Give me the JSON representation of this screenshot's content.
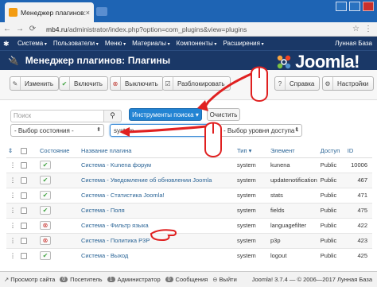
{
  "browser": {
    "tab_title": "Менеджер плагинов: П",
    "tab_close": "×",
    "url_host": "mb4.ru",
    "url_path": "/administrator/index.php?option=com_plugins&view=plugins"
  },
  "menu": {
    "items": [
      "Система",
      "Пользователи",
      "Меню",
      "Материалы",
      "Компоненты",
      "Расширения"
    ],
    "right": "Лунная База"
  },
  "header": {
    "title": "Менеджер плагинов: Плагины",
    "logo_text": "Joomla!"
  },
  "toolbar": {
    "edit": "Изменить",
    "enable": "Включить",
    "disable": "Выключить",
    "unlock": "Разблокировать",
    "help": "Справка",
    "options": "Настройки"
  },
  "filters": {
    "search_placeholder": "Поиск",
    "search_tools": "Инструменты поиска ▾",
    "clear": "Очистить",
    "state": "- Выбор состояния -",
    "folder": "system",
    "access": "- Выбор уровня доступа -"
  },
  "table": {
    "columns": [
      "",
      "",
      "Состояние",
      "Название плагина",
      "Тип ▾",
      "Элемент",
      "Доступ",
      "ID"
    ],
    "rows": [
      {
        "status": "on",
        "name": "Система - Kunena форум",
        "type": "system",
        "element": "kunena",
        "access": "Public",
        "id": "10006"
      },
      {
        "status": "on",
        "name": "Система - Уведомление об обновлении Joomla",
        "type": "system",
        "element": "updatenotification",
        "access": "Public",
        "id": "467"
      },
      {
        "status": "on",
        "name": "Система - Статистика Joomla!",
        "type": "system",
        "element": "stats",
        "access": "Public",
        "id": "471"
      },
      {
        "status": "on",
        "name": "Система - Поля",
        "type": "system",
        "element": "fields",
        "access": "Public",
        "id": "475"
      },
      {
        "status": "off",
        "name": "Система - Фильтр языка",
        "type": "system",
        "element": "languagefilter",
        "access": "Public",
        "id": "422"
      },
      {
        "status": "off",
        "name": "Система - Политика P3P",
        "type": "system",
        "element": "p3p",
        "access": "Public",
        "id": "423"
      },
      {
        "status": "on",
        "name": "Система - Выход",
        "type": "system",
        "element": "logout",
        "access": "Public",
        "id": "425"
      }
    ]
  },
  "statusbar": {
    "view_site": "Просмотр сайта",
    "visitors_count": "0",
    "visitors": "Посетитель",
    "admins_count": "1",
    "admins": "Администратор",
    "messages_count": "0",
    "messages": "Сообщения",
    "logout": "Выйти",
    "version": "Joomla! 3.7.4 — © 2006—2017 Лунная База"
  },
  "colors": {
    "admin_bar": "#1a3867",
    "browser_bar": "#1e64b4",
    "primary_button": "#2384d3",
    "annotation_red": "#e02020"
  }
}
